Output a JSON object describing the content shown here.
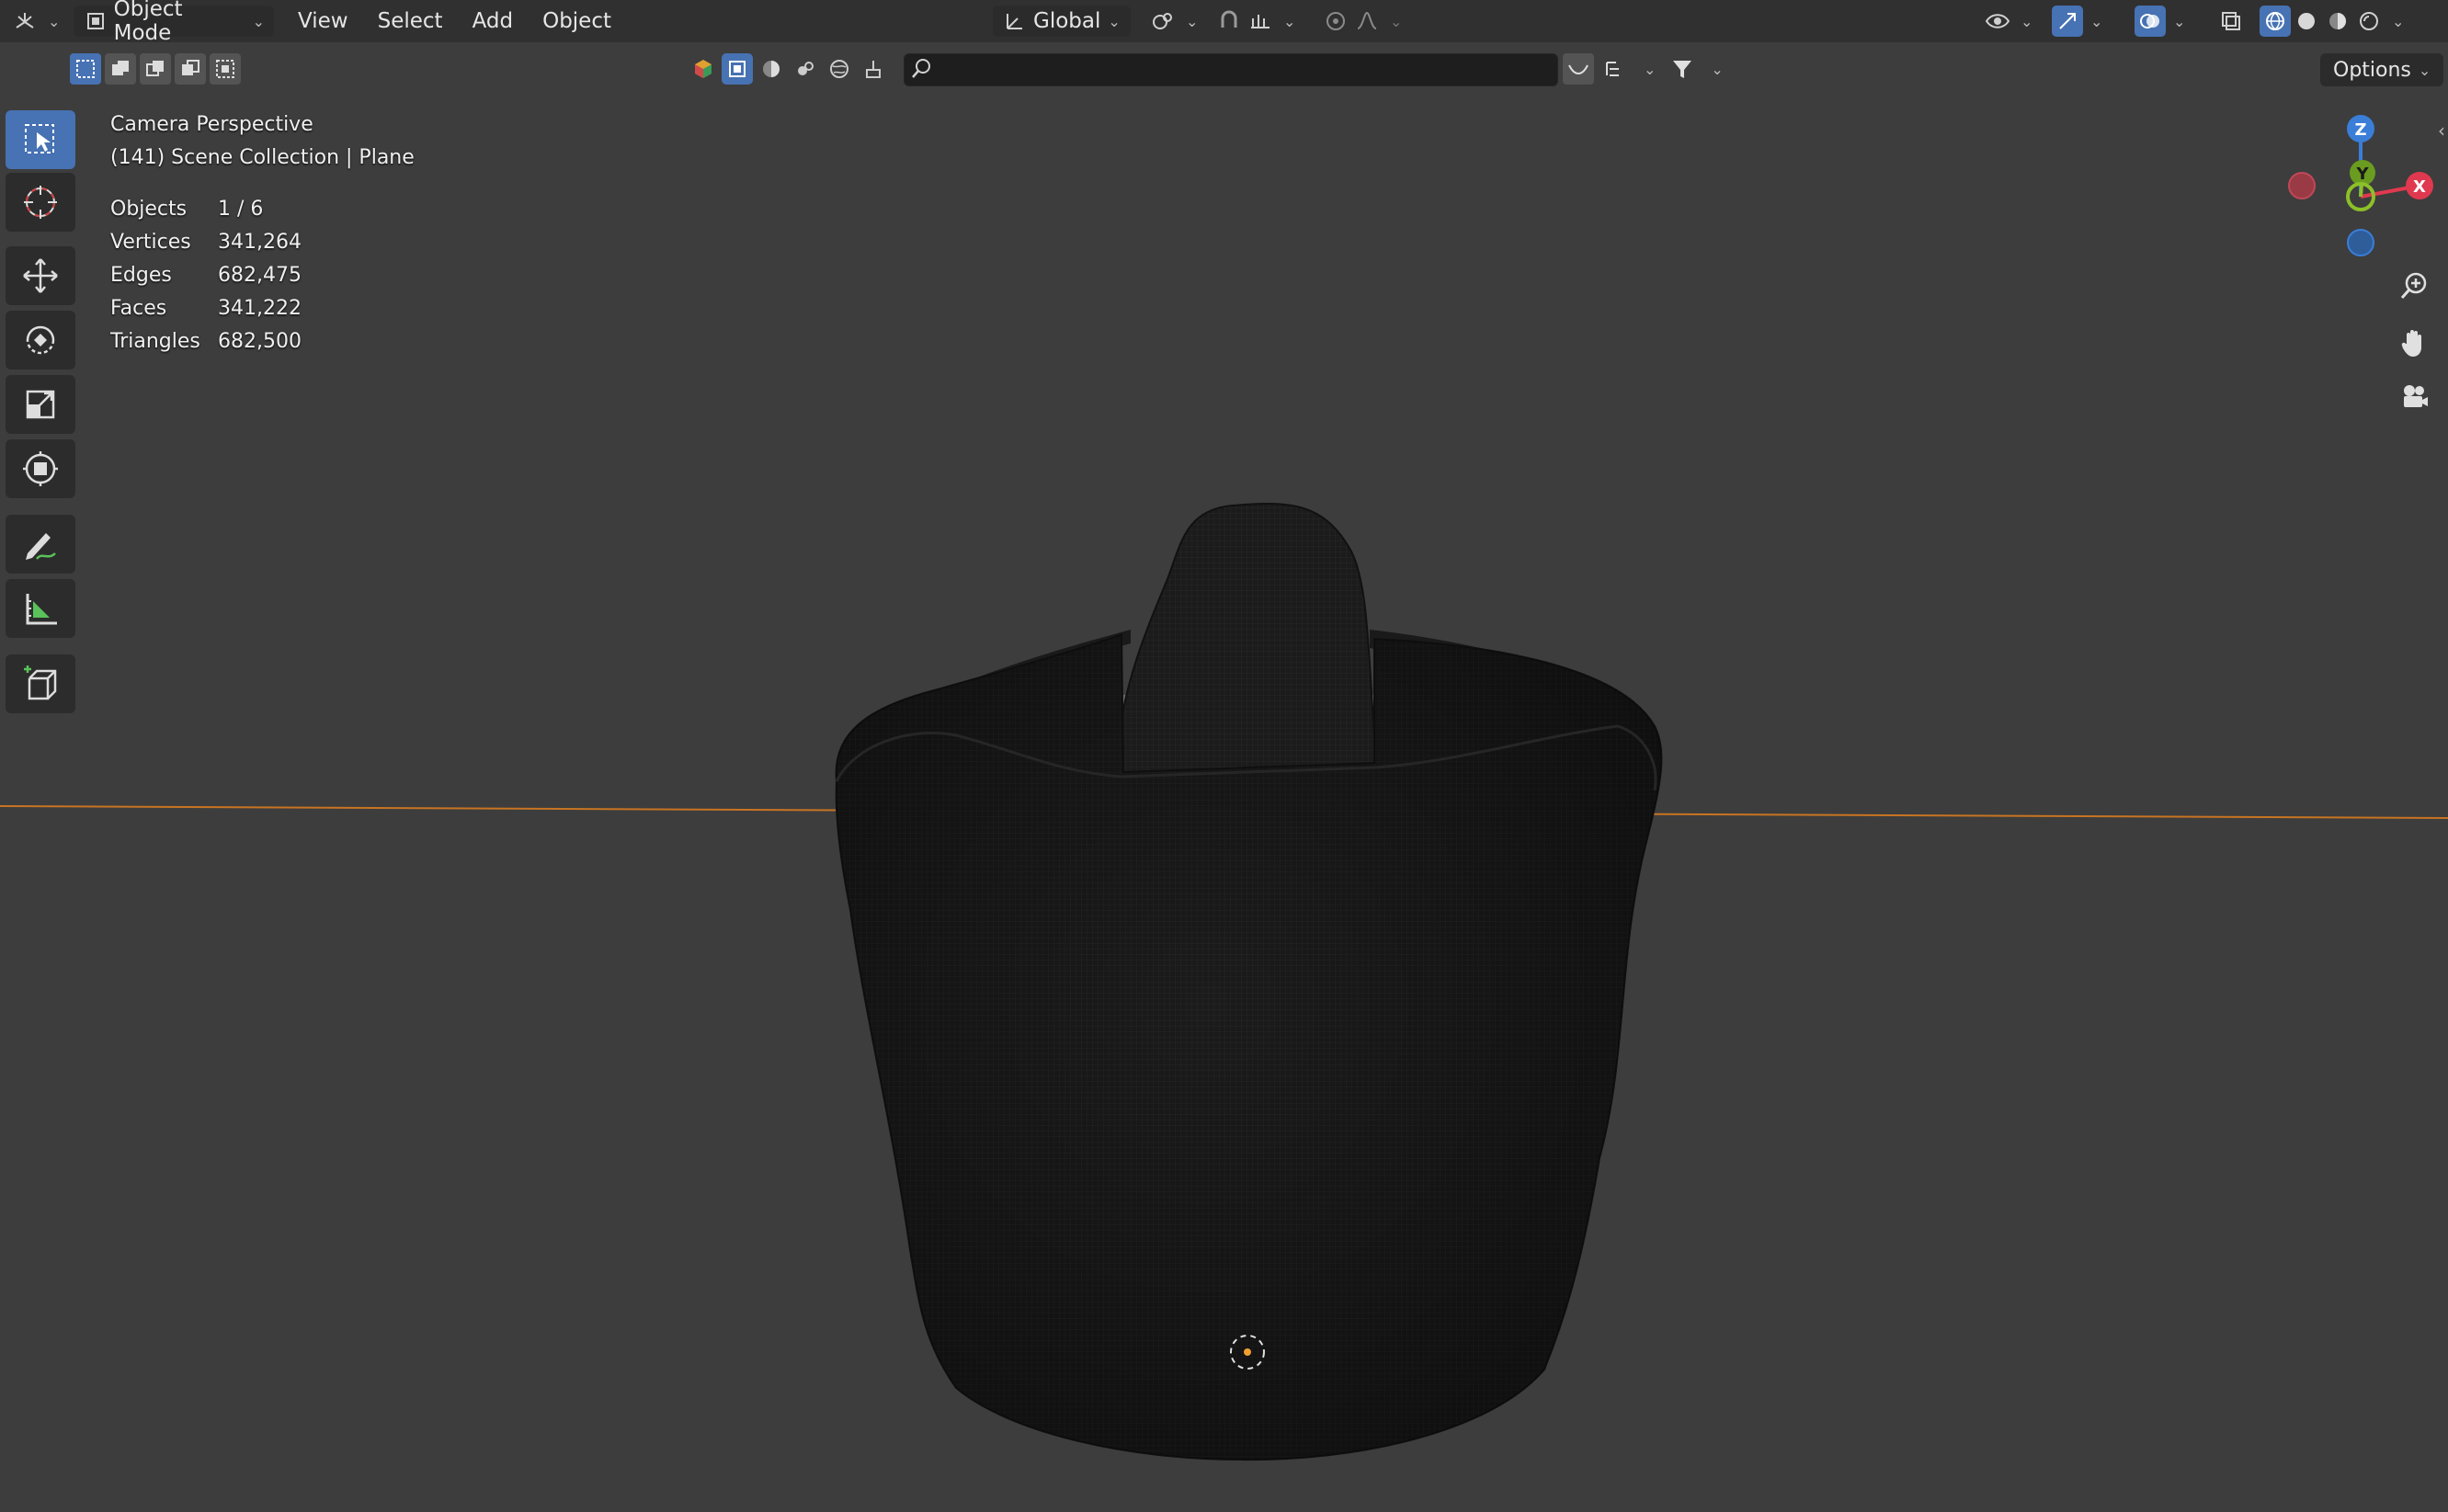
{
  "header": {
    "editor_type_icon": "editor-type-icon",
    "mode": "Object Mode",
    "menus": [
      "View",
      "Select",
      "Add",
      "Object"
    ],
    "transform_orientation": "Global",
    "options_label": "Options"
  },
  "search": {
    "value": ""
  },
  "overlay": {
    "view_name": "Camera Perspective",
    "collection": "(141) Scene Collection | Plane"
  },
  "stats": [
    {
      "label": "Objects",
      "value": "1 / 6"
    },
    {
      "label": "Vertices",
      "value": "341,264"
    },
    {
      "label": "Edges",
      "value": "682,475"
    },
    {
      "label": "Faces",
      "value": "341,222"
    },
    {
      "label": "Triangles",
      "value": "682,500"
    }
  ],
  "gizmo": {
    "x": "X",
    "y": "Y",
    "z": "Z"
  },
  "tools": [
    "select-box-icon",
    "cursor-icon",
    "move-icon",
    "rotate-icon",
    "scale-icon",
    "transform-icon",
    "annotate-icon",
    "measure-icon",
    "add-cube-icon"
  ],
  "colors": {
    "accent": "#4772b3",
    "viewport_bg": "#3d3d3d",
    "header_bg": "#303030",
    "axis_x": "#e0394f",
    "axis_y": "#8cc028",
    "axis_z": "#3a7ed8",
    "horizon_line": "#c87422"
  }
}
